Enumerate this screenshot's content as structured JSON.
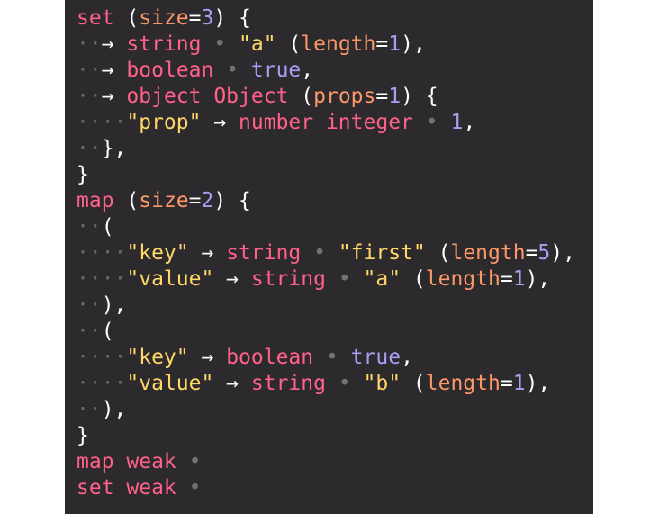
{
  "colors": {
    "background": "#2d2a2e",
    "keyword": "#ff6188",
    "number": "#ab9df2",
    "string": "#ffd866",
    "attribute": "#fc9867",
    "punctuation": "#fcfcfa",
    "whitespace_marker": "#6b686b"
  },
  "lines": [
    [
      {
        "t": "set",
        "c": "key"
      },
      {
        "t": " ",
        "c": "punc"
      },
      {
        "t": "(",
        "c": "punc"
      },
      {
        "t": "size",
        "c": "attr"
      },
      {
        "t": "=",
        "c": "punc"
      },
      {
        "t": "3",
        "c": "num"
      },
      {
        "t": ")",
        "c": "punc"
      },
      {
        "t": " {",
        "c": "punc"
      }
    ],
    [
      {
        "t": "··",
        "c": "ws"
      },
      {
        "t": "→ ",
        "c": "arrow"
      },
      {
        "t": "string",
        "c": "key"
      },
      {
        "t": " • ",
        "c": "sep"
      },
      {
        "t": "\"a\"",
        "c": "str"
      },
      {
        "t": " (",
        "c": "punc"
      },
      {
        "t": "length",
        "c": "attr"
      },
      {
        "t": "=",
        "c": "punc"
      },
      {
        "t": "1",
        "c": "num"
      },
      {
        "t": "),",
        "c": "punc"
      }
    ],
    [
      {
        "t": "··",
        "c": "ws"
      },
      {
        "t": "→ ",
        "c": "arrow"
      },
      {
        "t": "boolean",
        "c": "key"
      },
      {
        "t": " • ",
        "c": "sep"
      },
      {
        "t": "true",
        "c": "bool"
      },
      {
        "t": ",",
        "c": "punc"
      }
    ],
    [
      {
        "t": "··",
        "c": "ws"
      },
      {
        "t": "→ ",
        "c": "arrow"
      },
      {
        "t": "object Object",
        "c": "key"
      },
      {
        "t": " (",
        "c": "punc"
      },
      {
        "t": "props",
        "c": "attr"
      },
      {
        "t": "=",
        "c": "punc"
      },
      {
        "t": "1",
        "c": "num"
      },
      {
        "t": ") {",
        "c": "punc"
      }
    ],
    [
      {
        "t": "····",
        "c": "ws"
      },
      {
        "t": "\"prop\"",
        "c": "str"
      },
      {
        "t": " → ",
        "c": "arrow"
      },
      {
        "t": "number integer",
        "c": "key"
      },
      {
        "t": " • ",
        "c": "sep"
      },
      {
        "t": "1",
        "c": "num"
      },
      {
        "t": ",",
        "c": "punc"
      }
    ],
    [
      {
        "t": "··",
        "c": "ws"
      },
      {
        "t": "},",
        "c": "punc"
      }
    ],
    [
      {
        "t": "}",
        "c": "punc"
      }
    ],
    [
      {
        "t": "map",
        "c": "key"
      },
      {
        "t": " (",
        "c": "punc"
      },
      {
        "t": "size",
        "c": "attr"
      },
      {
        "t": "=",
        "c": "punc"
      },
      {
        "t": "2",
        "c": "num"
      },
      {
        "t": ") {",
        "c": "punc"
      }
    ],
    [
      {
        "t": "··",
        "c": "ws"
      },
      {
        "t": "(",
        "c": "punc"
      }
    ],
    [
      {
        "t": "····",
        "c": "ws"
      },
      {
        "t": "\"key\"",
        "c": "str"
      },
      {
        "t": " → ",
        "c": "arrow"
      },
      {
        "t": "string",
        "c": "key"
      },
      {
        "t": " • ",
        "c": "sep"
      },
      {
        "t": "\"first\"",
        "c": "str"
      },
      {
        "t": " (",
        "c": "punc"
      },
      {
        "t": "length",
        "c": "attr"
      },
      {
        "t": "=",
        "c": "punc"
      },
      {
        "t": "5",
        "c": "num"
      },
      {
        "t": "),",
        "c": "punc"
      }
    ],
    [
      {
        "t": "····",
        "c": "ws"
      },
      {
        "t": "\"value\"",
        "c": "str"
      },
      {
        "t": " → ",
        "c": "arrow"
      },
      {
        "t": "string",
        "c": "key"
      },
      {
        "t": " • ",
        "c": "sep"
      },
      {
        "t": "\"a\"",
        "c": "str"
      },
      {
        "t": " (",
        "c": "punc"
      },
      {
        "t": "length",
        "c": "attr"
      },
      {
        "t": "=",
        "c": "punc"
      },
      {
        "t": "1",
        "c": "num"
      },
      {
        "t": "),",
        "c": "punc"
      }
    ],
    [
      {
        "t": "··",
        "c": "ws"
      },
      {
        "t": "),",
        "c": "punc"
      }
    ],
    [
      {
        "t": "··",
        "c": "ws"
      },
      {
        "t": "(",
        "c": "punc"
      }
    ],
    [
      {
        "t": "····",
        "c": "ws"
      },
      {
        "t": "\"key\"",
        "c": "str"
      },
      {
        "t": " → ",
        "c": "arrow"
      },
      {
        "t": "boolean",
        "c": "key"
      },
      {
        "t": " • ",
        "c": "sep"
      },
      {
        "t": "true",
        "c": "bool"
      },
      {
        "t": ",",
        "c": "punc"
      }
    ],
    [
      {
        "t": "····",
        "c": "ws"
      },
      {
        "t": "\"value\"",
        "c": "str"
      },
      {
        "t": " → ",
        "c": "arrow"
      },
      {
        "t": "string",
        "c": "key"
      },
      {
        "t": " • ",
        "c": "sep"
      },
      {
        "t": "\"b\"",
        "c": "str"
      },
      {
        "t": " (",
        "c": "punc"
      },
      {
        "t": "length",
        "c": "attr"
      },
      {
        "t": "=",
        "c": "punc"
      },
      {
        "t": "1",
        "c": "num"
      },
      {
        "t": "),",
        "c": "punc"
      }
    ],
    [
      {
        "t": "··",
        "c": "ws"
      },
      {
        "t": "),",
        "c": "punc"
      }
    ],
    [
      {
        "t": "}",
        "c": "punc"
      }
    ],
    [
      {
        "t": "map weak",
        "c": "key"
      },
      {
        "t": " •",
        "c": "sep"
      }
    ],
    [
      {
        "t": "set weak",
        "c": "key"
      },
      {
        "t": " •",
        "c": "sep"
      }
    ]
  ]
}
